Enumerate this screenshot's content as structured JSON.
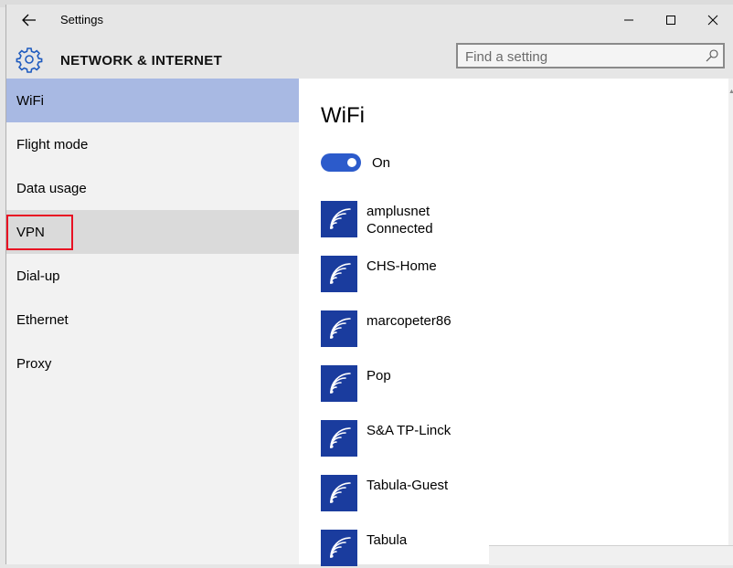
{
  "window": {
    "title": "Settings",
    "back_icon": "back-arrow-icon",
    "minimize_icon": "minimize-icon",
    "maximize_icon": "maximize-icon",
    "close_icon": "close-icon"
  },
  "header": {
    "icon": "gear-icon",
    "title": "NETWORK & INTERNET",
    "search_placeholder": "Find a setting",
    "search_icon": "search-icon"
  },
  "sidebar": {
    "items": [
      {
        "label": "WiFi",
        "state": "selected"
      },
      {
        "label": "Flight mode",
        "state": "normal"
      },
      {
        "label": "Data usage",
        "state": "normal"
      },
      {
        "label": "VPN",
        "state": "hover"
      },
      {
        "label": "Dial-up",
        "state": "normal"
      },
      {
        "label": "Ethernet",
        "state": "normal"
      },
      {
        "label": "Proxy",
        "state": "normal"
      }
    ],
    "highlight_color": "#e81123",
    "selected_color": "#a8b9e3"
  },
  "content": {
    "heading": "WiFi",
    "toggle": {
      "state": true,
      "label": "On",
      "color": "#2c5bcb"
    },
    "networks": [
      {
        "name": "amplusnet",
        "status": "Connected"
      },
      {
        "name": "CHS-Home",
        "status": ""
      },
      {
        "name": "marcopeter86",
        "status": ""
      },
      {
        "name": "Pop",
        "status": ""
      },
      {
        "name": "S&A TP-Linck",
        "status": ""
      },
      {
        "name": "Tabula-Guest",
        "status": ""
      },
      {
        "name": "Tabula",
        "status": ""
      }
    ],
    "network_icon": "wifi-signal-icon",
    "tile_color": "#1a3c9e"
  }
}
